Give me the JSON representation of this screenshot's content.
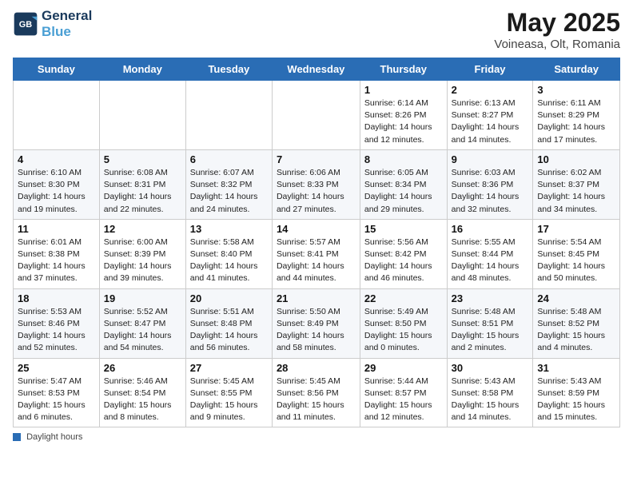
{
  "logo": {
    "line1": "General",
    "line2": "Blue"
  },
  "title": "May 2025",
  "subtitle": "Voineasa, Olt, Romania",
  "days_header": [
    "Sunday",
    "Monday",
    "Tuesday",
    "Wednesday",
    "Thursday",
    "Friday",
    "Saturday"
  ],
  "weeks": [
    [
      {
        "day": "",
        "info": ""
      },
      {
        "day": "",
        "info": ""
      },
      {
        "day": "",
        "info": ""
      },
      {
        "day": "",
        "info": ""
      },
      {
        "day": "1",
        "info": "Sunrise: 6:14 AM\nSunset: 8:26 PM\nDaylight: 14 hours\nand 12 minutes."
      },
      {
        "day": "2",
        "info": "Sunrise: 6:13 AM\nSunset: 8:27 PM\nDaylight: 14 hours\nand 14 minutes."
      },
      {
        "day": "3",
        "info": "Sunrise: 6:11 AM\nSunset: 8:29 PM\nDaylight: 14 hours\nand 17 minutes."
      }
    ],
    [
      {
        "day": "4",
        "info": "Sunrise: 6:10 AM\nSunset: 8:30 PM\nDaylight: 14 hours\nand 19 minutes."
      },
      {
        "day": "5",
        "info": "Sunrise: 6:08 AM\nSunset: 8:31 PM\nDaylight: 14 hours\nand 22 minutes."
      },
      {
        "day": "6",
        "info": "Sunrise: 6:07 AM\nSunset: 8:32 PM\nDaylight: 14 hours\nand 24 minutes."
      },
      {
        "day": "7",
        "info": "Sunrise: 6:06 AM\nSunset: 8:33 PM\nDaylight: 14 hours\nand 27 minutes."
      },
      {
        "day": "8",
        "info": "Sunrise: 6:05 AM\nSunset: 8:34 PM\nDaylight: 14 hours\nand 29 minutes."
      },
      {
        "day": "9",
        "info": "Sunrise: 6:03 AM\nSunset: 8:36 PM\nDaylight: 14 hours\nand 32 minutes."
      },
      {
        "day": "10",
        "info": "Sunrise: 6:02 AM\nSunset: 8:37 PM\nDaylight: 14 hours\nand 34 minutes."
      }
    ],
    [
      {
        "day": "11",
        "info": "Sunrise: 6:01 AM\nSunset: 8:38 PM\nDaylight: 14 hours\nand 37 minutes."
      },
      {
        "day": "12",
        "info": "Sunrise: 6:00 AM\nSunset: 8:39 PM\nDaylight: 14 hours\nand 39 minutes."
      },
      {
        "day": "13",
        "info": "Sunrise: 5:58 AM\nSunset: 8:40 PM\nDaylight: 14 hours\nand 41 minutes."
      },
      {
        "day": "14",
        "info": "Sunrise: 5:57 AM\nSunset: 8:41 PM\nDaylight: 14 hours\nand 44 minutes."
      },
      {
        "day": "15",
        "info": "Sunrise: 5:56 AM\nSunset: 8:42 PM\nDaylight: 14 hours\nand 46 minutes."
      },
      {
        "day": "16",
        "info": "Sunrise: 5:55 AM\nSunset: 8:44 PM\nDaylight: 14 hours\nand 48 minutes."
      },
      {
        "day": "17",
        "info": "Sunrise: 5:54 AM\nSunset: 8:45 PM\nDaylight: 14 hours\nand 50 minutes."
      }
    ],
    [
      {
        "day": "18",
        "info": "Sunrise: 5:53 AM\nSunset: 8:46 PM\nDaylight: 14 hours\nand 52 minutes."
      },
      {
        "day": "19",
        "info": "Sunrise: 5:52 AM\nSunset: 8:47 PM\nDaylight: 14 hours\nand 54 minutes."
      },
      {
        "day": "20",
        "info": "Sunrise: 5:51 AM\nSunset: 8:48 PM\nDaylight: 14 hours\nand 56 minutes."
      },
      {
        "day": "21",
        "info": "Sunrise: 5:50 AM\nSunset: 8:49 PM\nDaylight: 14 hours\nand 58 minutes."
      },
      {
        "day": "22",
        "info": "Sunrise: 5:49 AM\nSunset: 8:50 PM\nDaylight: 15 hours\nand 0 minutes."
      },
      {
        "day": "23",
        "info": "Sunrise: 5:48 AM\nSunset: 8:51 PM\nDaylight: 15 hours\nand 2 minutes."
      },
      {
        "day": "24",
        "info": "Sunrise: 5:48 AM\nSunset: 8:52 PM\nDaylight: 15 hours\nand 4 minutes."
      }
    ],
    [
      {
        "day": "25",
        "info": "Sunrise: 5:47 AM\nSunset: 8:53 PM\nDaylight: 15 hours\nand 6 minutes."
      },
      {
        "day": "26",
        "info": "Sunrise: 5:46 AM\nSunset: 8:54 PM\nDaylight: 15 hours\nand 8 minutes."
      },
      {
        "day": "27",
        "info": "Sunrise: 5:45 AM\nSunset: 8:55 PM\nDaylight: 15 hours\nand 9 minutes."
      },
      {
        "day": "28",
        "info": "Sunrise: 5:45 AM\nSunset: 8:56 PM\nDaylight: 15 hours\nand 11 minutes."
      },
      {
        "day": "29",
        "info": "Sunrise: 5:44 AM\nSunset: 8:57 PM\nDaylight: 15 hours\nand 12 minutes."
      },
      {
        "day": "30",
        "info": "Sunrise: 5:43 AM\nSunset: 8:58 PM\nDaylight: 15 hours\nand 14 minutes."
      },
      {
        "day": "31",
        "info": "Sunrise: 5:43 AM\nSunset: 8:59 PM\nDaylight: 15 hours\nand 15 minutes."
      }
    ]
  ],
  "legend": "Daylight hours"
}
